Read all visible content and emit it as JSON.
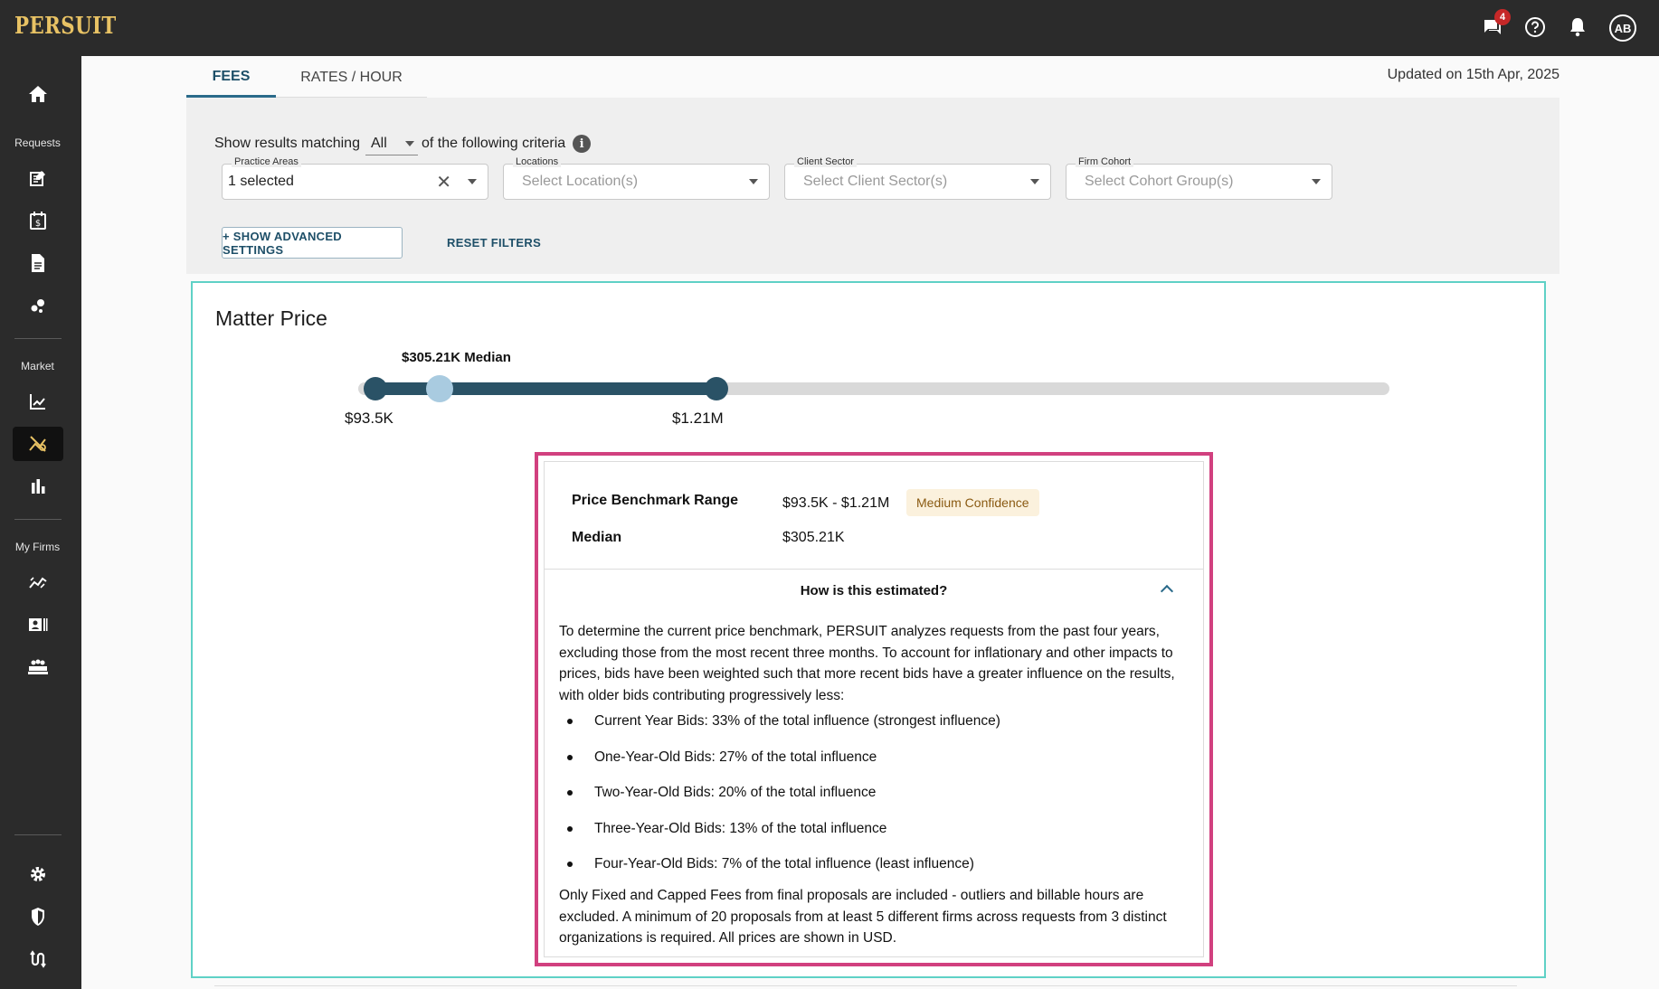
{
  "app": {
    "logo": "PERSUIT"
  },
  "topbar": {
    "messages_badge": "4",
    "avatar_initials": "AB",
    "icons": [
      "chat-icon",
      "help-icon",
      "bell-icon"
    ]
  },
  "sidebar": {
    "sections": {
      "requests": "Requests",
      "market": "Market",
      "my_firms": "My Firms"
    },
    "icons": [
      "home-icon",
      "request-list-icon",
      "calendar-dollar-icon",
      "document-icon",
      "bubbles-icon",
      "line-chart-icon",
      "price-analysis-icon",
      "bar-chart-icon",
      "firm-performance-icon",
      "firm-card-icon",
      "team-icon",
      "settings-icon",
      "shield-icon",
      "integration-icon"
    ]
  },
  "tabs": [
    {
      "label": "FEES",
      "active": true
    },
    {
      "label": "RATES / HOUR",
      "active": false
    }
  ],
  "updated": "Updated on 15th Apr, 2025",
  "filters": {
    "criteria_prefix": "Show results matching",
    "criteria_value": "All",
    "criteria_suffix": "of the following criteria",
    "fields": [
      {
        "label": "Practice Areas",
        "value": "1 selected",
        "placeholder": ""
      },
      {
        "label": "Locations",
        "value": "",
        "placeholder": "Select Location(s)"
      },
      {
        "label": "Client Sector",
        "value": "",
        "placeholder": "Select Client Sector(s)"
      },
      {
        "label": "Firm Cohort",
        "value": "",
        "placeholder": "Select Cohort Group(s)"
      }
    ],
    "advanced_button": "+ SHOW ADVANCED SETTINGS",
    "reset_button": "RESET FILTERS"
  },
  "matter_price": {
    "title": "Matter Price",
    "median_label": "$305.21K Median",
    "min_label": "$93.5K",
    "max_label": "$1.21M",
    "details": {
      "range_label": "Price Benchmark Range",
      "range_value": "$93.5K - $1.21M",
      "confidence": "Medium Confidence",
      "median_label": "Median",
      "median_value": "$305.21K",
      "accordion_title": "How is this estimated?",
      "intro": "To determine the current price benchmark, PERSUIT analyzes requests from the past four years, excluding those from the most recent three months. To account for inflationary and other impacts to prices, bids have been weighted such that more recent bids have a greater influence on the results, with older bids contributing progressively less:",
      "bullets": [
        "Current Year Bids: 33% of the total influence (strongest influence)",
        "One-Year-Old Bids: 27% of the total influence",
        "Two-Year-Old Bids: 20% of the total influence",
        "Three-Year-Old Bids: 13% of the total influence",
        "Four-Year-Old Bids: 7% of the total influence (least influence)"
      ],
      "footer": "Only Fixed and Capped Fees from final proposals are included - outliers and billable hours are excluded. A minimum of 20 proposals from at least 5 different firms across requests from 3 distinct organizations is required. All prices are shown in USD."
    }
  },
  "colors": {
    "topbar": "#2b2b2b",
    "logo": "#e8c264",
    "accent": "#2a5266",
    "card_border": "#5fd1c6",
    "highlight_border": "#d1407f",
    "confidence_bg": "#fbf1dd"
  }
}
